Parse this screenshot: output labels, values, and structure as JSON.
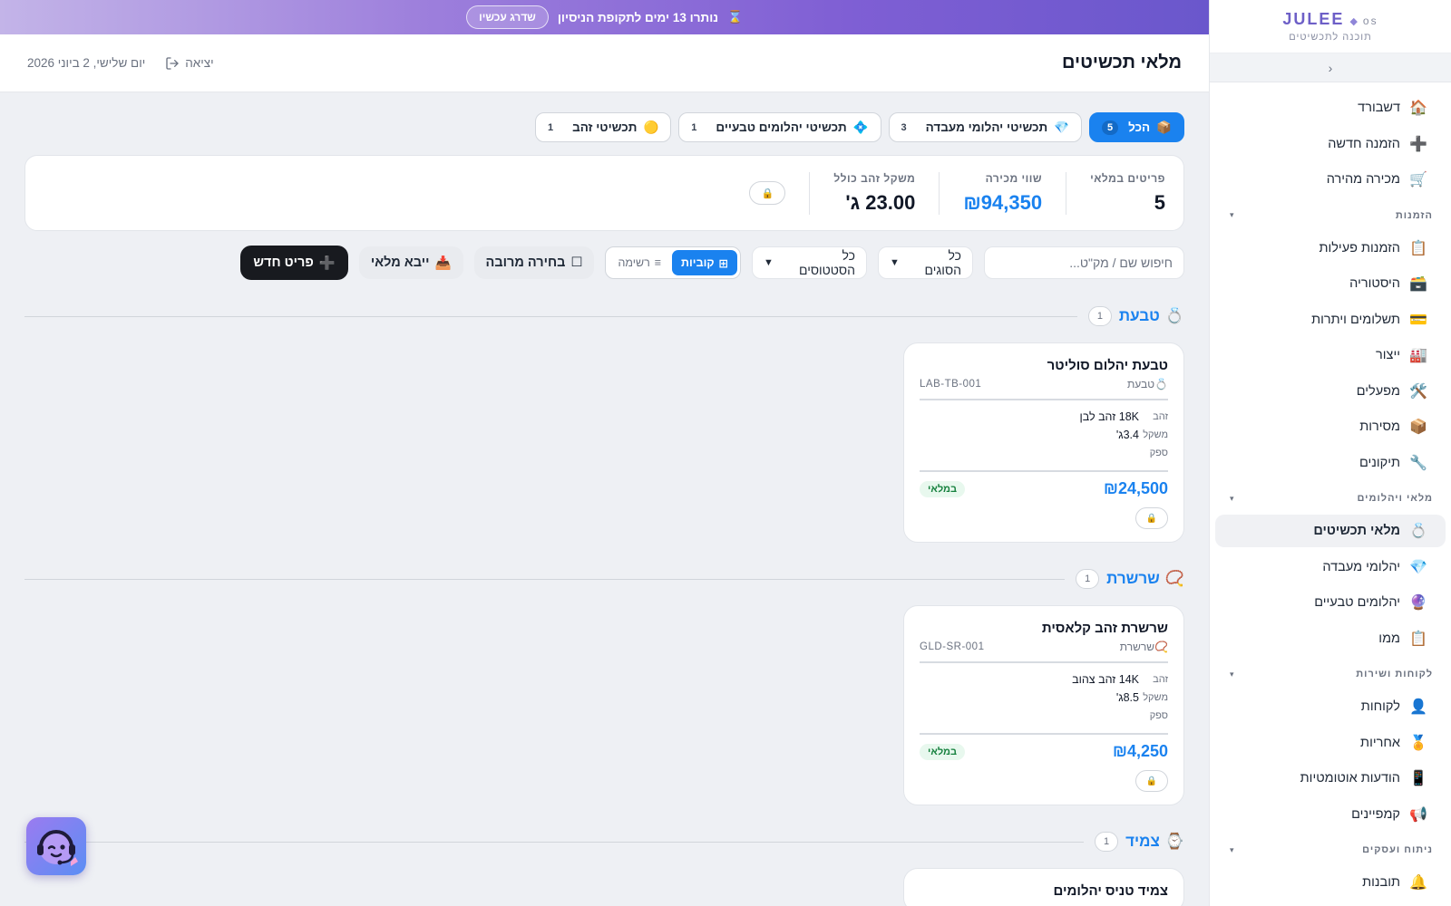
{
  "brand": {
    "name": "JULEE",
    "os": "os",
    "subtitle": "תוכנה לתכשיטים"
  },
  "sidebar": {
    "collapse_icon": "chevron-left-icon",
    "items_top": [
      {
        "label": "דשבורד",
        "icon": "🏠",
        "icon_name": "home-icon"
      },
      {
        "label": "הזמנה חדשה",
        "icon": "➕",
        "icon_name": "plus-icon"
      },
      {
        "label": "מכירה מהירה",
        "icon": "🛒",
        "icon_name": "cart-icon"
      }
    ],
    "sections": [
      {
        "title": "הזמנות",
        "items": [
          {
            "label": "הזמנות פעילות",
            "icon": "📋",
            "icon_name": "clipboard-icon"
          },
          {
            "label": "היסטוריה",
            "icon": "🗃️",
            "icon_name": "archive-box-icon"
          },
          {
            "label": "תשלומים ויתרות",
            "icon": "💳",
            "icon_name": "credit-card-icon"
          },
          {
            "label": "ייצור",
            "icon": "🏭",
            "icon_name": "factory-icon"
          },
          {
            "label": "מפעלים",
            "icon": "🛠️",
            "icon_name": "tools-icon"
          },
          {
            "label": "מסירות",
            "icon": "📦",
            "icon_name": "package-icon"
          },
          {
            "label": "תיקונים",
            "icon": "🔧",
            "icon_name": "wrench-icon"
          }
        ]
      },
      {
        "title": "מלאי ויהלומים",
        "items": [
          {
            "label": "מלאי תכשיטים",
            "icon": "💍",
            "icon_name": "ring-icon",
            "active": true
          },
          {
            "label": "יהלומי מעבדה",
            "icon": "💎",
            "icon_name": "diamond-icon"
          },
          {
            "label": "יהלומים טבעיים",
            "icon": "🔮",
            "icon_name": "crystal-ball-icon"
          },
          {
            "label": "ממו",
            "icon": "📋",
            "icon_name": "memo-icon"
          }
        ]
      },
      {
        "title": "לקוחות ושירות",
        "items": [
          {
            "label": "לקוחות",
            "icon": "👤",
            "icon_name": "user-icon"
          },
          {
            "label": "אחריות",
            "icon": "🏅",
            "icon_name": "medal-icon"
          },
          {
            "label": "הודעות אוטומטיות",
            "icon": "📱",
            "icon_name": "phone-icon"
          },
          {
            "label": "קמפיינים",
            "icon": "📢",
            "icon_name": "megaphone-icon"
          }
        ]
      },
      {
        "title": "ניתוח ועסקים",
        "items": [
          {
            "label": "תובנות",
            "icon": "🔔",
            "icon_name": "bell-icon"
          }
        ]
      }
    ]
  },
  "trial": {
    "text": "נותרו 13 ימים לתקופת הניסיון",
    "icon": "⌛",
    "button": "שדרג עכשיו"
  },
  "header": {
    "title": "מלאי תכשיטים",
    "logout": "יציאה",
    "date": "יום שלישי, 2 ביוני 2026"
  },
  "tabs": [
    {
      "label": "הכל",
      "icon": "📦",
      "count": "5",
      "active": true
    },
    {
      "label": "תכשיטי יהלומי מעבדה",
      "icon": "💎",
      "count": "3"
    },
    {
      "label": "תכשיטי יהלומים טבעיים",
      "icon": "💠",
      "count": "1"
    },
    {
      "label": "תכשיטי זהב",
      "icon": "🟡",
      "count": "1"
    }
  ],
  "stats": [
    {
      "label": "פריטים במלאי",
      "value": "5",
      "accent": false
    },
    {
      "label": "שווי מכירה",
      "value": "₪94,350",
      "accent": true
    },
    {
      "label": "משקל זהב כולל",
      "value": "23.00 ג'",
      "accent": false
    }
  ],
  "stats_lock_icon": "🔒",
  "toolbar": {
    "search_placeholder": "חיפוש שם / מק\"ט...",
    "type_filter": "כל הסוגים",
    "status_filter": "כל הסטטוסים",
    "view_cards": "קוביות",
    "view_list": "רשימה",
    "bulk_select": "בחירה מרובה",
    "import": "ייבא מלאי",
    "new_item": "פריט חדש"
  },
  "groups": [
    {
      "title": "טבעת",
      "icon": "💍",
      "count": "1",
      "cards": [
        {
          "name": "טבעת יהלום סוליטר",
          "type": "טבעת",
          "type_icon": "💍",
          "sku": "LAB-TB-001",
          "gold_label": "זהב",
          "gold": "18K זהב לבן",
          "weight_label": "משקל",
          "weight": "3.4ג'",
          "supplier_label": "ספק",
          "price": "₪24,500",
          "status": "במלאי"
        }
      ]
    },
    {
      "title": "שרשרת",
      "icon": "📿",
      "count": "1",
      "cards": [
        {
          "name": "שרשרת זהב קלאסית",
          "type": "שרשרת",
          "type_icon": "📿",
          "sku": "GLD-SR-001",
          "gold_label": "זהב",
          "gold": "14K זהב צהוב",
          "weight_label": "משקל",
          "weight": "8.5ג'",
          "supplier_label": "ספק",
          "price": "₪4,250",
          "status": "במלאי"
        }
      ]
    },
    {
      "title": "צמיד",
      "icon": "⌚",
      "count": "1",
      "cards": [
        {
          "name": "צמיד טניס יהלומים",
          "type": "",
          "type_icon": "",
          "sku": "",
          "gold_label": "",
          "gold": "",
          "weight_label": "",
          "weight": "",
          "supplier_label": "",
          "price": "",
          "status": ""
        }
      ]
    }
  ],
  "colors": {
    "accent": "#1a82ef",
    "trial_start": "#c3b4e8",
    "trial_end": "#6a57cc",
    "dark_button": "#181a1f",
    "success": "#15803d"
  }
}
